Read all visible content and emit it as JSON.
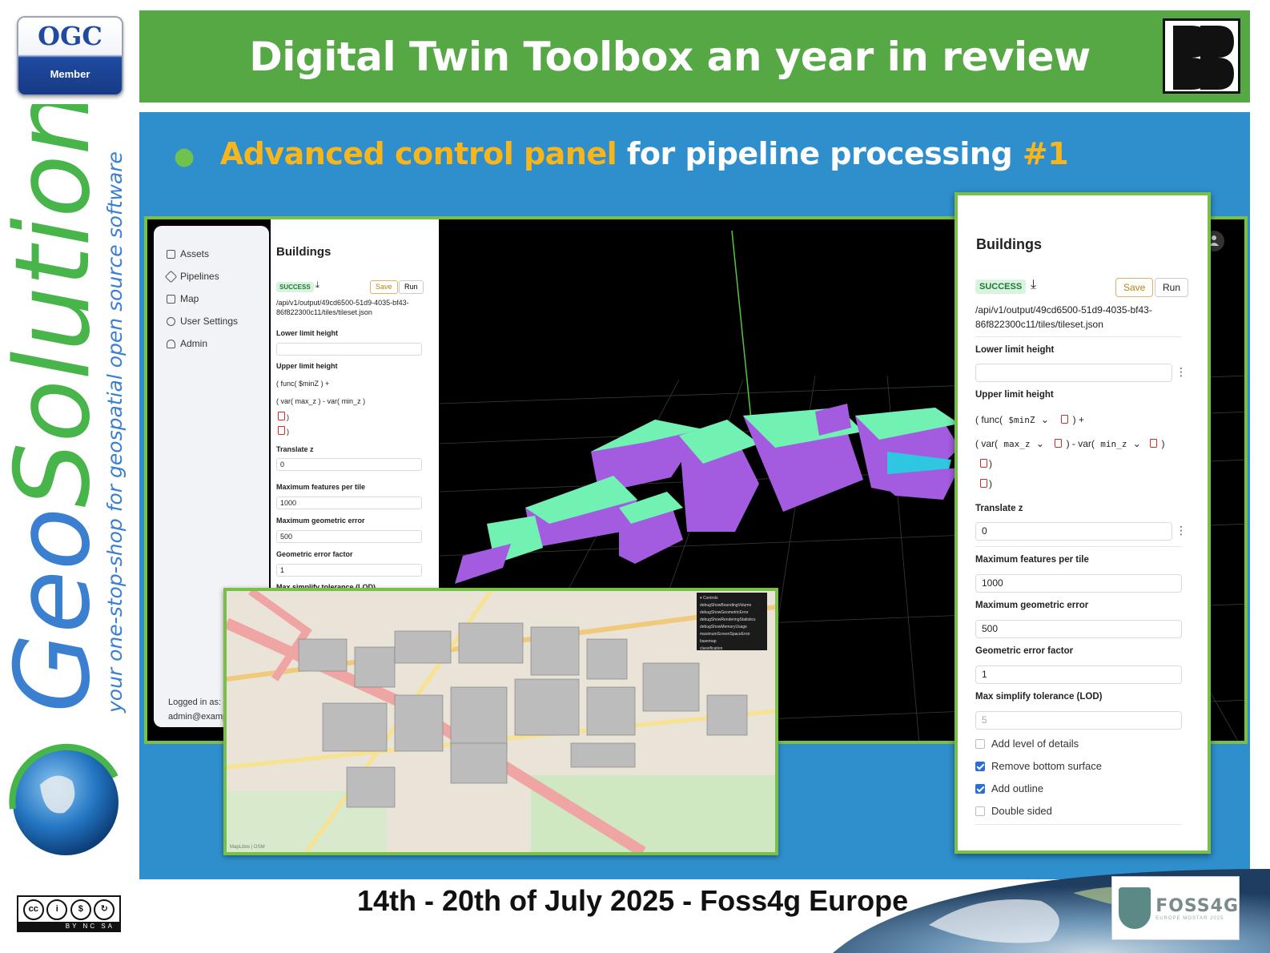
{
  "slide": {
    "title": "Digital Twin Toolbox an year in review",
    "bullet": {
      "part1": "Advanced control panel",
      "part2": " for pipeline processing ",
      "part3": "#1"
    },
    "footer": "14th - 20th of July 2025 - Foss4g Europe",
    "colors": {
      "green": "#56a845",
      "blue": "#2f8fcc",
      "highlight": "#f9b51c",
      "border": "#78c04a"
    }
  },
  "logos": {
    "ogc_word": "OGC",
    "ogc_member": "Member",
    "geosolutions_word": "GeoSolutions",
    "geosolutions_tagline": "your one-stop-shop for geospatial open source software",
    "cc": "BY NC SA",
    "foss4g_name": "FOSS4G",
    "foss4g_sub": "EUROPE MOSTAR 2025"
  },
  "app": {
    "nav": [
      {
        "label": "Assets",
        "icon": "file-icon"
      },
      {
        "label": "Pipelines",
        "icon": "cube-icon"
      },
      {
        "label": "Map",
        "icon": "map-icon"
      },
      {
        "label": "User Settings",
        "icon": "gear-icon"
      },
      {
        "label": "Admin",
        "icon": "users-icon"
      }
    ],
    "logged_label": "Logged in as:",
    "logged_user": "admin@example",
    "pipeline": {
      "title": "Buildings",
      "status": "SUCCESS",
      "save": "Save",
      "run": "Run",
      "path1": "/api/v1/output/49cd6500-51d9-4035-bf43-",
      "path2": "86f822300c11/tiles/tileset.json",
      "lower_limit_label": "Lower limit height",
      "lower_limit_value": "",
      "upper_limit_label": "Upper limit height",
      "expr_func": "( func(",
      "expr_minZ": "$minZ",
      "expr_plus": ") +",
      "expr_var1": "( var(",
      "expr_max_z": "max_z",
      "expr_minus": ") - var(",
      "expr_min_z": "min_z",
      "expr_close1": ")",
      "expr_close2": ")",
      "expr_close3": ")",
      "translate_label": "Translate z",
      "translate_value": "0",
      "max_features_label": "Maximum features per tile",
      "max_features_value": "1000",
      "max_geom_error_label": "Maximum geometric error",
      "max_geom_error_value": "500",
      "geom_factor_label": "Geometric error factor",
      "geom_factor_value": "1",
      "simplify_label": "Max simplify tolerance (LOD)",
      "simplify_value": "5",
      "checks": [
        {
          "label": "Add level of details",
          "checked": false
        },
        {
          "label": "Remove bottom surface",
          "checked": true
        },
        {
          "label": "Add outline",
          "checked": true
        },
        {
          "label": "Double sided",
          "checked": false
        }
      ]
    },
    "map_controls": {
      "title": "▾ Controls",
      "items": [
        "debugShowBoundingVolume",
        "debugShowGeometricError",
        "debugShowRenderingStatistics",
        "debugShowMemoryUsage",
        "maximumScreenSpaceError",
        "basemap",
        "classification"
      ]
    },
    "map_attribution": "MapLibre | OSM"
  }
}
